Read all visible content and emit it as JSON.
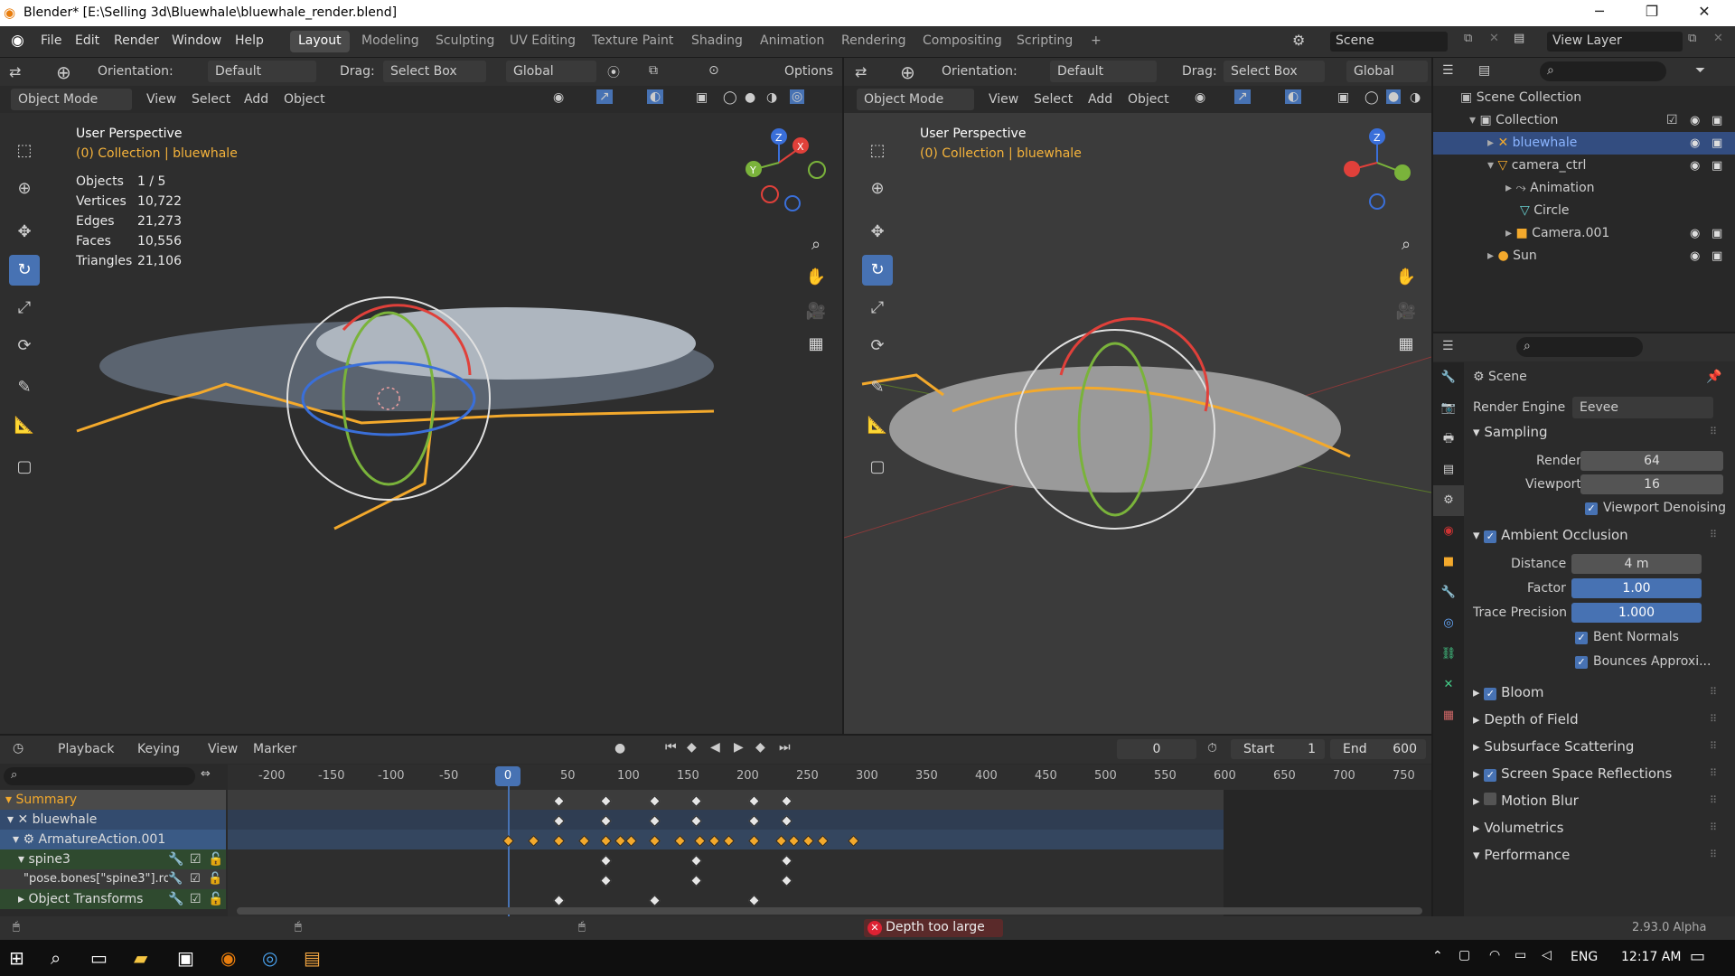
{
  "window": {
    "title": "Blender* [E:\\Selling 3d\\Bluewhale\\bluewhale_render.blend]",
    "min": "─",
    "max": "❐",
    "close": "✕"
  },
  "menu": [
    "File",
    "Edit",
    "Render",
    "Window",
    "Help"
  ],
  "workspaces": [
    "Layout",
    "Modeling",
    "Sculpting",
    "UV Editing",
    "Texture Paint",
    "Shading",
    "Animation",
    "Rendering",
    "Compositing",
    "Scripting",
    "+"
  ],
  "scene": {
    "label": "Scene",
    "view_layer": "View Layer"
  },
  "viewport_header": {
    "orientation_label": "Orientation:",
    "orientation_value": "Default",
    "drag_label": "Drag:",
    "drag_value": "Select Box",
    "transform": "Global",
    "options": "Options"
  },
  "viewport_header2": {
    "mode": "Object Mode",
    "view": "View",
    "select": "Select",
    "add": "Add",
    "object": "Object"
  },
  "left_vp": {
    "title": "User Perspective",
    "collection": "(0) Collection | bluewhale",
    "stats": [
      {
        "k": "Objects",
        "v": "1 / 5"
      },
      {
        "k": "Vertices",
        "v": "10,722"
      },
      {
        "k": "Edges",
        "v": "21,273"
      },
      {
        "k": "Faces",
        "v": "10,556"
      },
      {
        "k": "Triangles",
        "v": "21,106"
      }
    ]
  },
  "right_vp": {
    "title": "User Perspective",
    "collection": "(0) Collection | bluewhale"
  },
  "gizmo": {
    "x": "X",
    "y": "Y",
    "z": "Z"
  },
  "outliner": {
    "items": [
      {
        "label": "Scene Collection",
        "indent": 0
      },
      {
        "label": "Collection",
        "indent": 1
      },
      {
        "label": "bluewhale",
        "indent": 2,
        "selected": true
      },
      {
        "label": "camera_ctrl",
        "indent": 2
      },
      {
        "label": "Animation",
        "indent": 3
      },
      {
        "label": "Circle",
        "indent": 3
      },
      {
        "label": "Camera.001",
        "indent": 3
      },
      {
        "label": "Sun",
        "indent": 2
      }
    ]
  },
  "properties": {
    "context": "Scene",
    "render_engine_label": "Render Engine",
    "render_engine": "Eevee",
    "sampling": "Sampling",
    "render_label": "Render",
    "render_val": "64",
    "viewport_label": "Viewport",
    "viewport_val": "16",
    "denoise": "Viewport Denoising",
    "ao": "Ambient Occlusion",
    "distance_label": "Distance",
    "distance_val": "4 m",
    "factor_label": "Factor",
    "factor_val": "1.00",
    "trace_label": "Trace Precision",
    "trace_val": "1.000",
    "bent": "Bent Normals",
    "bounces": "Bounces Approxi...",
    "panels": [
      {
        "label": "Bloom",
        "check": true
      },
      {
        "label": "Depth of Field",
        "check": null
      },
      {
        "label": "Subsurface Scattering",
        "check": null
      },
      {
        "label": "Screen Space Reflections",
        "check": true
      },
      {
        "label": "Motion Blur",
        "check": false
      },
      {
        "label": "Volumetrics",
        "check": null
      },
      {
        "label": "Performance",
        "check": null
      }
    ]
  },
  "timeline": {
    "playback": "Playback",
    "keying": "Keying",
    "view": "View",
    "marker": "Marker",
    "frame": "0",
    "start_label": "Start",
    "start": "1",
    "end_label": "End",
    "end": "600",
    "ticks": [
      "-200",
      "-150",
      "-100",
      "-50",
      "0",
      "50",
      "100",
      "150",
      "200",
      "250",
      "300",
      "350",
      "400",
      "450",
      "500",
      "550",
      "600",
      "650",
      "700",
      "750"
    ],
    "channels": [
      "Summary",
      "bluewhale",
      "ArmatureAction.001",
      "spine3",
      "\"pose.bones[\"spine3\"].ro",
      "Object Transforms"
    ]
  },
  "status": {
    "error": "Depth too large",
    "version": "2.93.0 Alpha"
  },
  "taskbar": {
    "lang": "ENG",
    "time": "12:17 AM"
  }
}
